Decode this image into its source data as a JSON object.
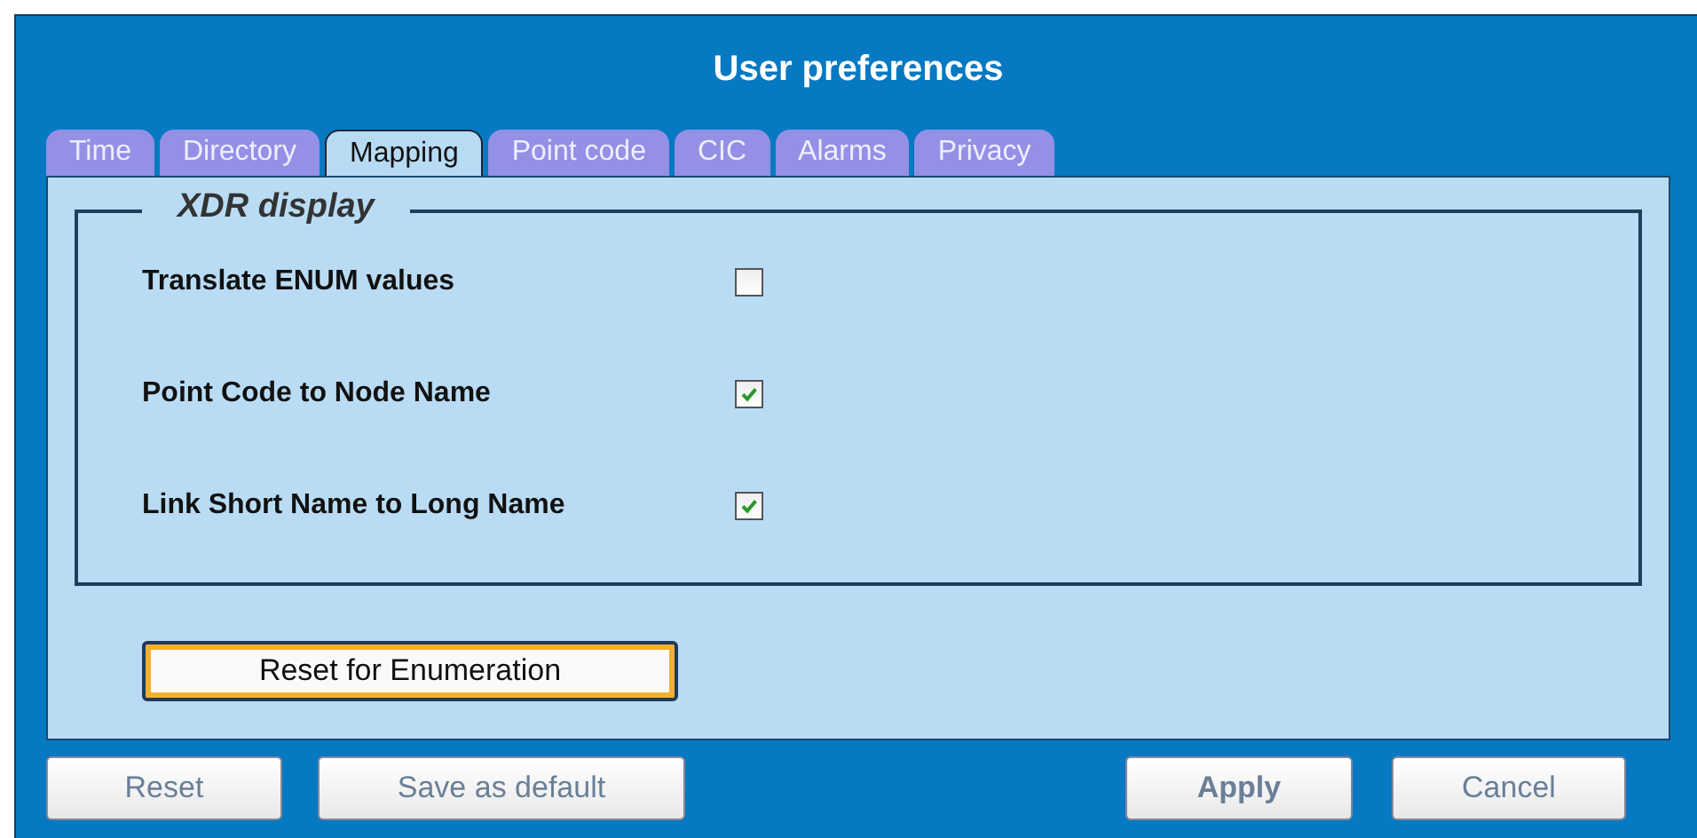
{
  "window": {
    "title": "User preferences"
  },
  "tabs": [
    {
      "label": "Time",
      "selected": false
    },
    {
      "label": "Directory",
      "selected": false
    },
    {
      "label": "Mapping",
      "selected": true
    },
    {
      "label": "Point code",
      "selected": false
    },
    {
      "label": "CIC",
      "selected": false
    },
    {
      "label": "Alarms",
      "selected": false
    },
    {
      "label": "Privacy",
      "selected": false
    }
  ],
  "group": {
    "legend": "XDR display",
    "options": [
      {
        "label": "Translate ENUM values",
        "checked": false
      },
      {
        "label": "Point Code to Node Name",
        "checked": true
      },
      {
        "label": "Link Short Name to Long Name",
        "checked": true
      }
    ]
  },
  "action_button": {
    "label": "Reset for Enumeration",
    "focused": true
  },
  "footer_buttons": [
    {
      "label": "Reset",
      "default": false
    },
    {
      "label": "Save as default",
      "default": false
    },
    {
      "label": "Apply",
      "default": true
    },
    {
      "label": "Cancel",
      "default": false
    }
  ]
}
